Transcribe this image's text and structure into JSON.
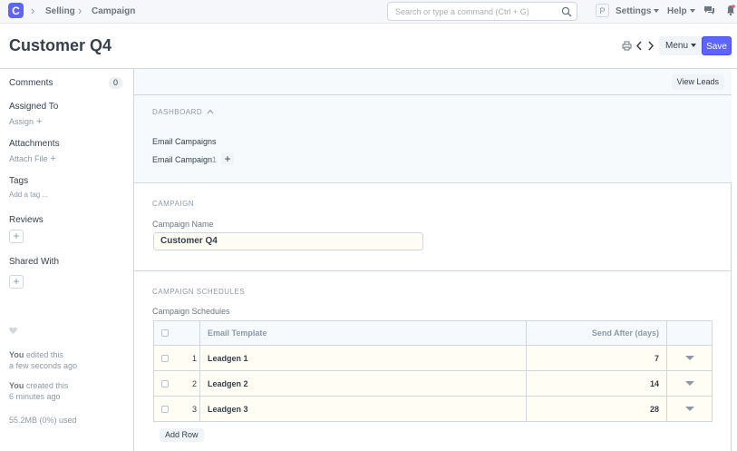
{
  "navbar": {
    "logo_letter": "C",
    "breadcrumbs": [
      "Selling",
      "Campaign"
    ],
    "search_placeholder": "Search or type a command (Ctrl + G)",
    "avatar_letter": "P",
    "menus": [
      "Settings",
      "Help"
    ]
  },
  "page": {
    "title": "Customer Q4",
    "menu_label": "Menu",
    "save_label": "Save"
  },
  "sidebar": {
    "comments_label": "Comments",
    "comments_count": "0",
    "assigned_to_label": "Assigned To",
    "assign_link": "Assign",
    "attachments_label": "Attachments",
    "attach_link": "Attach File",
    "tags_label": "Tags",
    "add_tag_link": "Add a tag ...",
    "reviews_label": "Reviews",
    "shared_with_label": "Shared With",
    "edited_by": "You",
    "edited_text": " edited this",
    "edited_time": "a few seconds ago",
    "created_by": "You",
    "created_text": " created this",
    "created_time": "6 minutes ago",
    "usage": "55.2MB (0%) used"
  },
  "main": {
    "view_leads_label": "View Leads",
    "dashboard": {
      "title": "DASHBOARD",
      "group_label": "Email Campaigns",
      "link_label": "Email Campaign",
      "link_count": "1"
    },
    "campaign": {
      "title": "CAMPAIGN",
      "name_label": "Campaign Name",
      "name_value": "Customer Q4"
    },
    "schedules": {
      "title": "CAMPAIGN SCHEDULES",
      "table_label": "Campaign Schedules",
      "columns": [
        "Email Template",
        "Send After (days)"
      ],
      "rows": [
        {
          "idx": "1",
          "template": "Leadgen 1",
          "days": "7"
        },
        {
          "idx": "2",
          "template": "Leadgen 2",
          "days": "14"
        },
        {
          "idx": "3",
          "template": "Leadgen 3",
          "days": "28"
        }
      ],
      "add_row_label": "Add Row"
    }
  },
  "colors": {
    "primary": "#5e64ff",
    "text": "#36414c",
    "muted": "#8d99a6",
    "border": "#d1d8dd",
    "input_bg": "#fffdf4"
  }
}
